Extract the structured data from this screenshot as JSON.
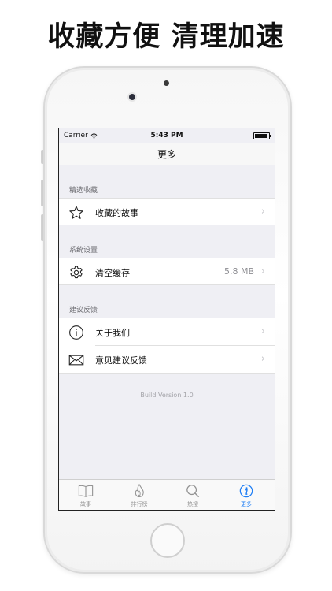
{
  "promo": {
    "headline": "收藏方便 清理加速"
  },
  "status_bar": {
    "carrier": "Carrier",
    "time": "5:43 PM"
  },
  "nav": {
    "title": "更多"
  },
  "sections": [
    {
      "header": "精选收藏",
      "rows": [
        {
          "icon": "star-icon",
          "label": "收藏的故事",
          "detail": ""
        }
      ]
    },
    {
      "header": "系统设置",
      "rows": [
        {
          "icon": "gear-icon",
          "label": "清空缓存",
          "detail": "5.8 MB"
        }
      ]
    },
    {
      "header": "建议反馈",
      "rows": [
        {
          "icon": "info-icon",
          "label": "关于我们",
          "detail": ""
        },
        {
          "icon": "envelope-icon",
          "label": "意见建议反馈",
          "detail": ""
        }
      ]
    }
  ],
  "footer": {
    "version": "Build Version 1.0"
  },
  "tabbar": {
    "tabs": [
      {
        "icon": "book-icon",
        "label": "故事",
        "active": false
      },
      {
        "icon": "flame-icon",
        "label": "排行榜",
        "active": false
      },
      {
        "icon": "search-icon",
        "label": "热搜",
        "active": false
      },
      {
        "icon": "info-circle-icon",
        "label": "更多",
        "active": true
      }
    ],
    "active_color": "#1e7ef5",
    "inactive_color": "#929292"
  }
}
